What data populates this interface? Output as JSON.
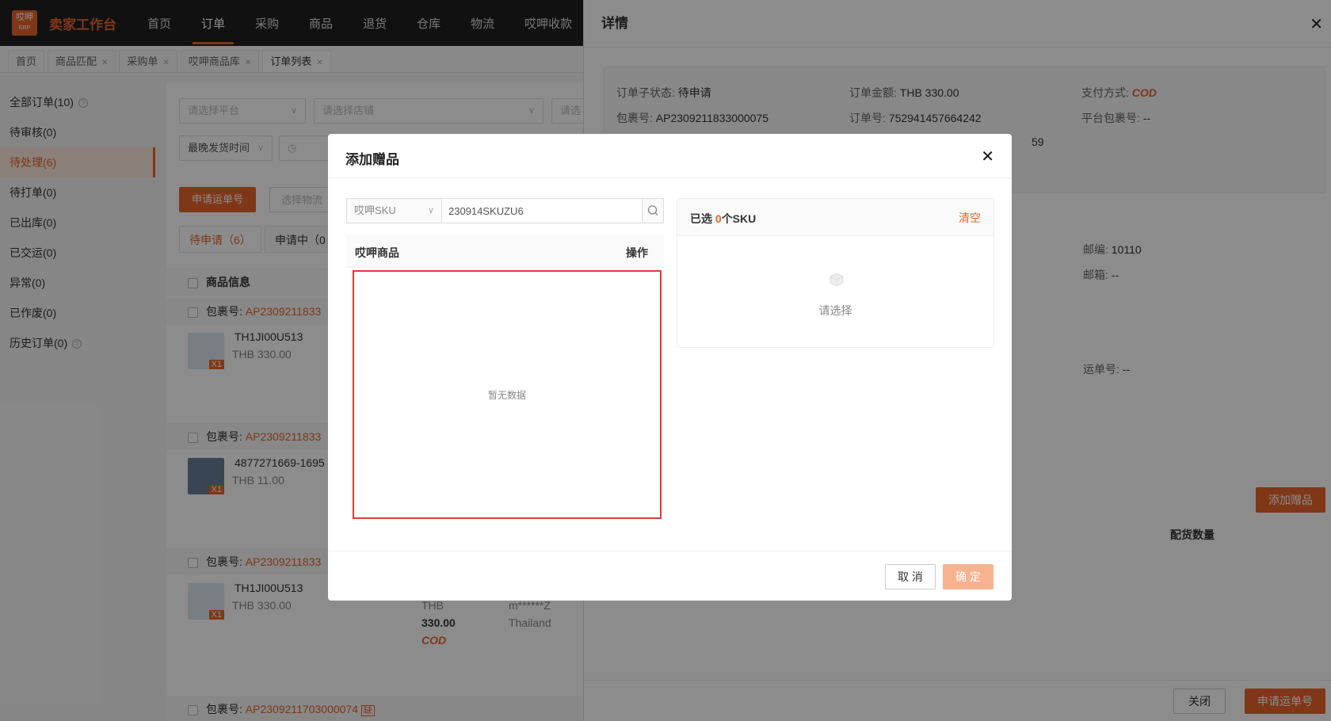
{
  "app": {
    "logo_text": "哎呷",
    "logo_sub": "ERP",
    "brand": "卖家工作台"
  },
  "nav": [
    "首页",
    "订单",
    "采购",
    "商品",
    "退货",
    "仓库",
    "物流",
    "哎呷收款"
  ],
  "page_tabs": [
    "首页",
    "商品匹配",
    "采购单",
    "哎呷商品库",
    "订单列表"
  ],
  "left_menu": [
    "全部订单(10)",
    "待审核(0)",
    "待处理(6)",
    "待打单(0)",
    "已出库(0)",
    "已交运(0)",
    "异常(0)",
    "已作废(0)",
    "历史订单(0)"
  ],
  "filters": {
    "platform": "请选择平台",
    "store": "请选择店铺",
    "store_extra": "请选",
    "ship_time": "最晚发货时间"
  },
  "actions": {
    "apply_waybill": "申请运单号",
    "choose_logistics": "选择物流"
  },
  "sub_tabs": [
    "待申请（6）",
    "申请中（0"
  ],
  "table_header": "商品信息",
  "package_label": "包裹号:",
  "orders": [
    {
      "package": "AP2309211833",
      "sku": "TH1JI00U513",
      "price": "THB 330.00",
      "qty": "X1"
    },
    {
      "package": "AP2309211833",
      "sku": "4877271669-1695",
      "price": "THB 11.00",
      "qty": "X1"
    },
    {
      "package": "AP2309211833",
      "sku": "TH1JI00U513",
      "price": "THB 330.00",
      "qty": "X1",
      "amount_currency": "THB",
      "amount": "330.00",
      "payment": "COD",
      "buyer": "m******Z",
      "country": "Thailand"
    },
    {
      "package": "AP2309211703000074",
      "flag": "缺"
    }
  ],
  "drawer": {
    "title": "详情",
    "fields": {
      "sub_status_k": "订单子状态:",
      "sub_status_v": "待申请",
      "amount_k": "订单金额:",
      "amount_v": "THB 330.00",
      "pay_k": "支付方式:",
      "pay_v": "COD",
      "package_k": "包裹号:",
      "package_v": "AP2309211833000075",
      "order_k": "订单号:",
      "order_v": "752941457664242",
      "platform_pkg_k": "平台包裹号:",
      "platform_pkg_v": "--",
      "partial_num": "59",
      "zip_k": "邮编:",
      "zip_v": "10110",
      "email_k": "邮箱:",
      "email_v": "--",
      "waybill_k": "运单号:",
      "waybill_v": "--"
    },
    "add_gift": "添加赠品",
    "dist_qty": "配货数量",
    "close": "关闭",
    "apply": "申请运单号"
  },
  "modal": {
    "title": "添加赠品",
    "sku_type": "哎呷SKU",
    "search_value": "230914SKUZU6",
    "col_product": "哎呷商品",
    "col_action": "操作",
    "empty": "暂无数据",
    "selected_prefix": "已选",
    "selected_count": "0",
    "selected_suffix": "个SKU",
    "clear": "清空",
    "please_select": "请选择",
    "cancel": "取 消",
    "ok": "确 定"
  }
}
